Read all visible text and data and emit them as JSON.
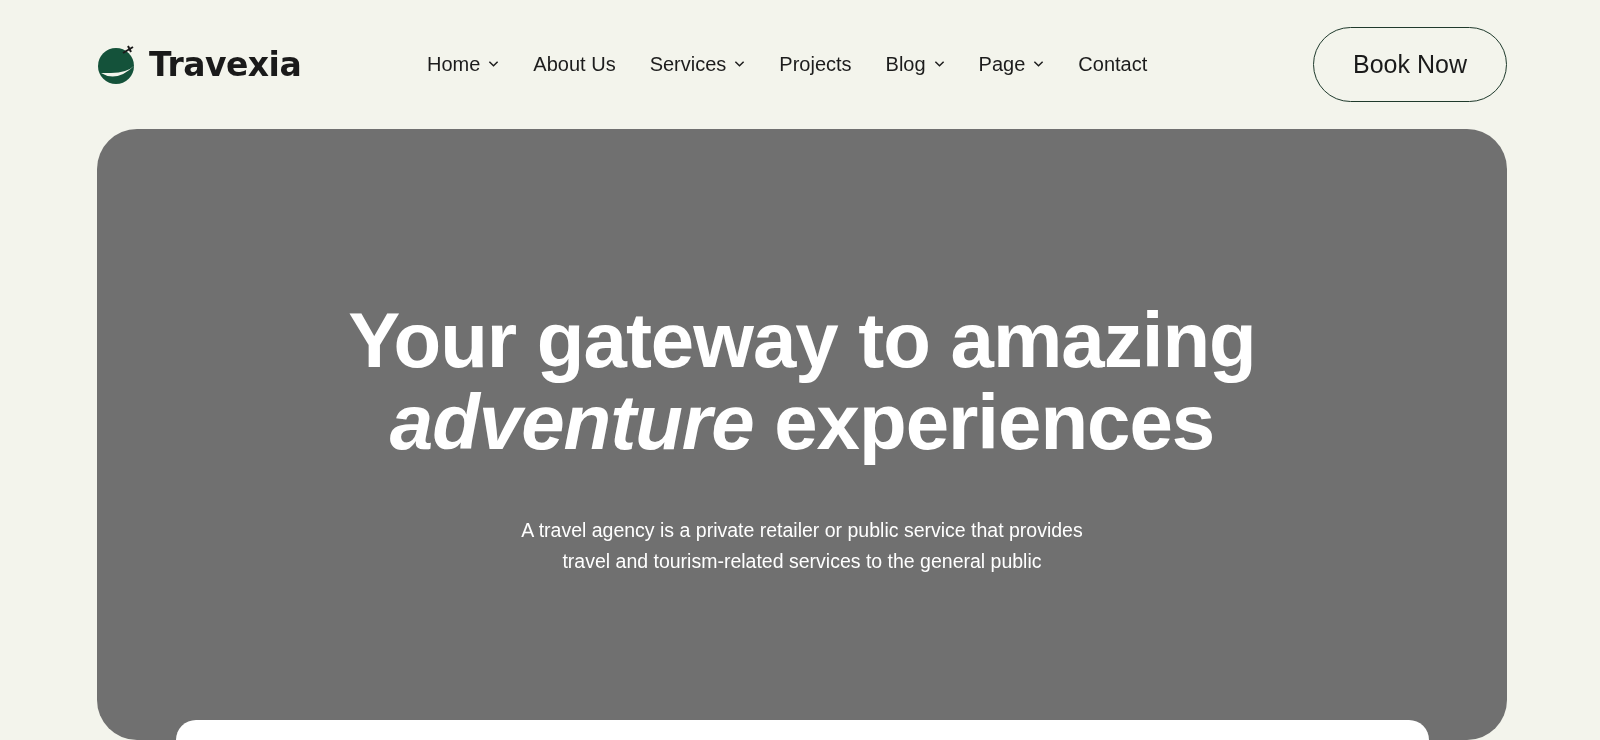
{
  "logo": {
    "text": "Travexia"
  },
  "nav": [
    {
      "label": "Home",
      "dropdown": true
    },
    {
      "label": "About Us",
      "dropdown": false
    },
    {
      "label": "Services",
      "dropdown": true
    },
    {
      "label": "Projects",
      "dropdown": false
    },
    {
      "label": "Blog",
      "dropdown": true
    },
    {
      "label": "Page",
      "dropdown": true
    },
    {
      "label": "Contact",
      "dropdown": false
    }
  ],
  "cta": "Book Now",
  "hero": {
    "title": "Your gateway to amazing *adventure* experiences",
    "subtitle": "A travel agency is a private retailer or public service that provides travel and tourism-related services to the general public"
  }
}
